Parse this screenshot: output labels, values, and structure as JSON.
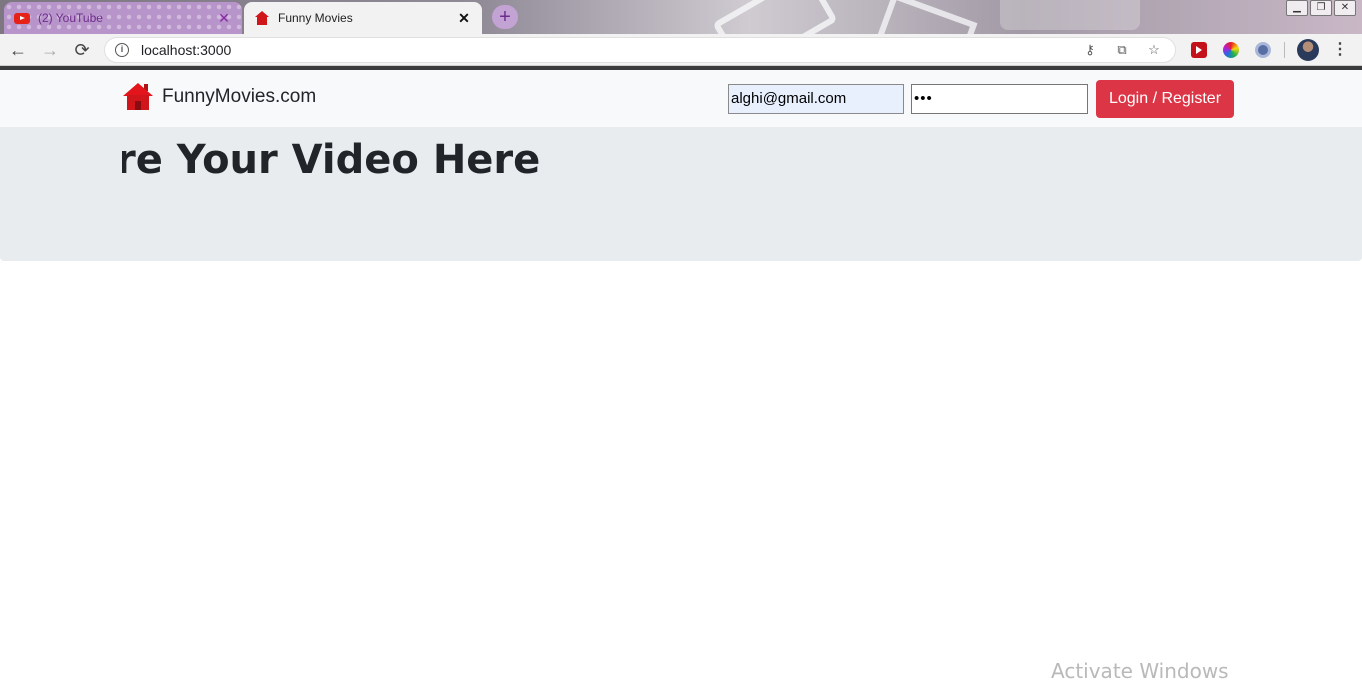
{
  "browser": {
    "tabs": [
      {
        "title": "(2) YouTube",
        "favicon": "youtube-icon",
        "active": false
      },
      {
        "title": "Funny Movies",
        "favicon": "house-icon",
        "active": true
      }
    ],
    "new_tab_symbol": "+",
    "close_symbol": "✕",
    "address": "localhost:3000",
    "window_controls": {
      "minimize": "▁",
      "restore": "❐",
      "close": "✕"
    },
    "nav": {
      "back": "←",
      "forward": "→",
      "reload": "⟳"
    },
    "omnibox_icons": {
      "key": "⚷",
      "translate": "⧉",
      "star": "☆"
    },
    "menu": "⋮"
  },
  "app": {
    "brand": "FunnyMovies.com",
    "email_value": "alghi@gmail.com",
    "password_value": "•••",
    "login_button": "Login / Register",
    "banner_text": "Share Your Video Here",
    "accent_color": "#dc3545"
  },
  "os": {
    "watermark": "Activate Windows"
  }
}
